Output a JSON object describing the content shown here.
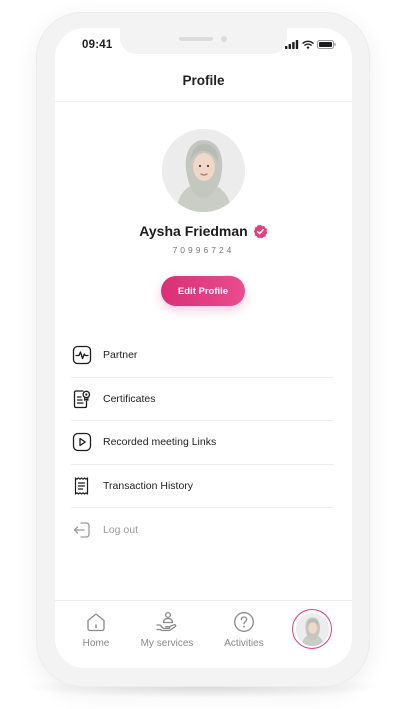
{
  "status_bar": {
    "time": "09:41"
  },
  "header": {
    "title": "Profile"
  },
  "profile": {
    "name": "Aysha Friedman",
    "id": "70996724",
    "edit_label": "Edit Profile",
    "verified": true
  },
  "menu": {
    "items": [
      {
        "label": "Partner",
        "icon": "pulse-icon"
      },
      {
        "label": "Certificates",
        "icon": "certificate-icon"
      },
      {
        "label": "Recorded meeting Links",
        "icon": "video-play-icon"
      },
      {
        "label": "Transaction History",
        "icon": "receipt-icon"
      },
      {
        "label": "Log out",
        "icon": "logout-icon"
      }
    ]
  },
  "tabs": [
    {
      "label": "Home",
      "icon": "home-icon"
    },
    {
      "label": "My services",
      "icon": "service-hand-icon"
    },
    {
      "label": "Activities",
      "icon": "question-circle-icon"
    },
    {
      "label": "",
      "icon": "avatar"
    }
  ],
  "colors": {
    "accent": "#e03f82",
    "accent_dark": "#d92f77",
    "frame": "#f3f3f4",
    "muted_text": "#8a8a90"
  }
}
